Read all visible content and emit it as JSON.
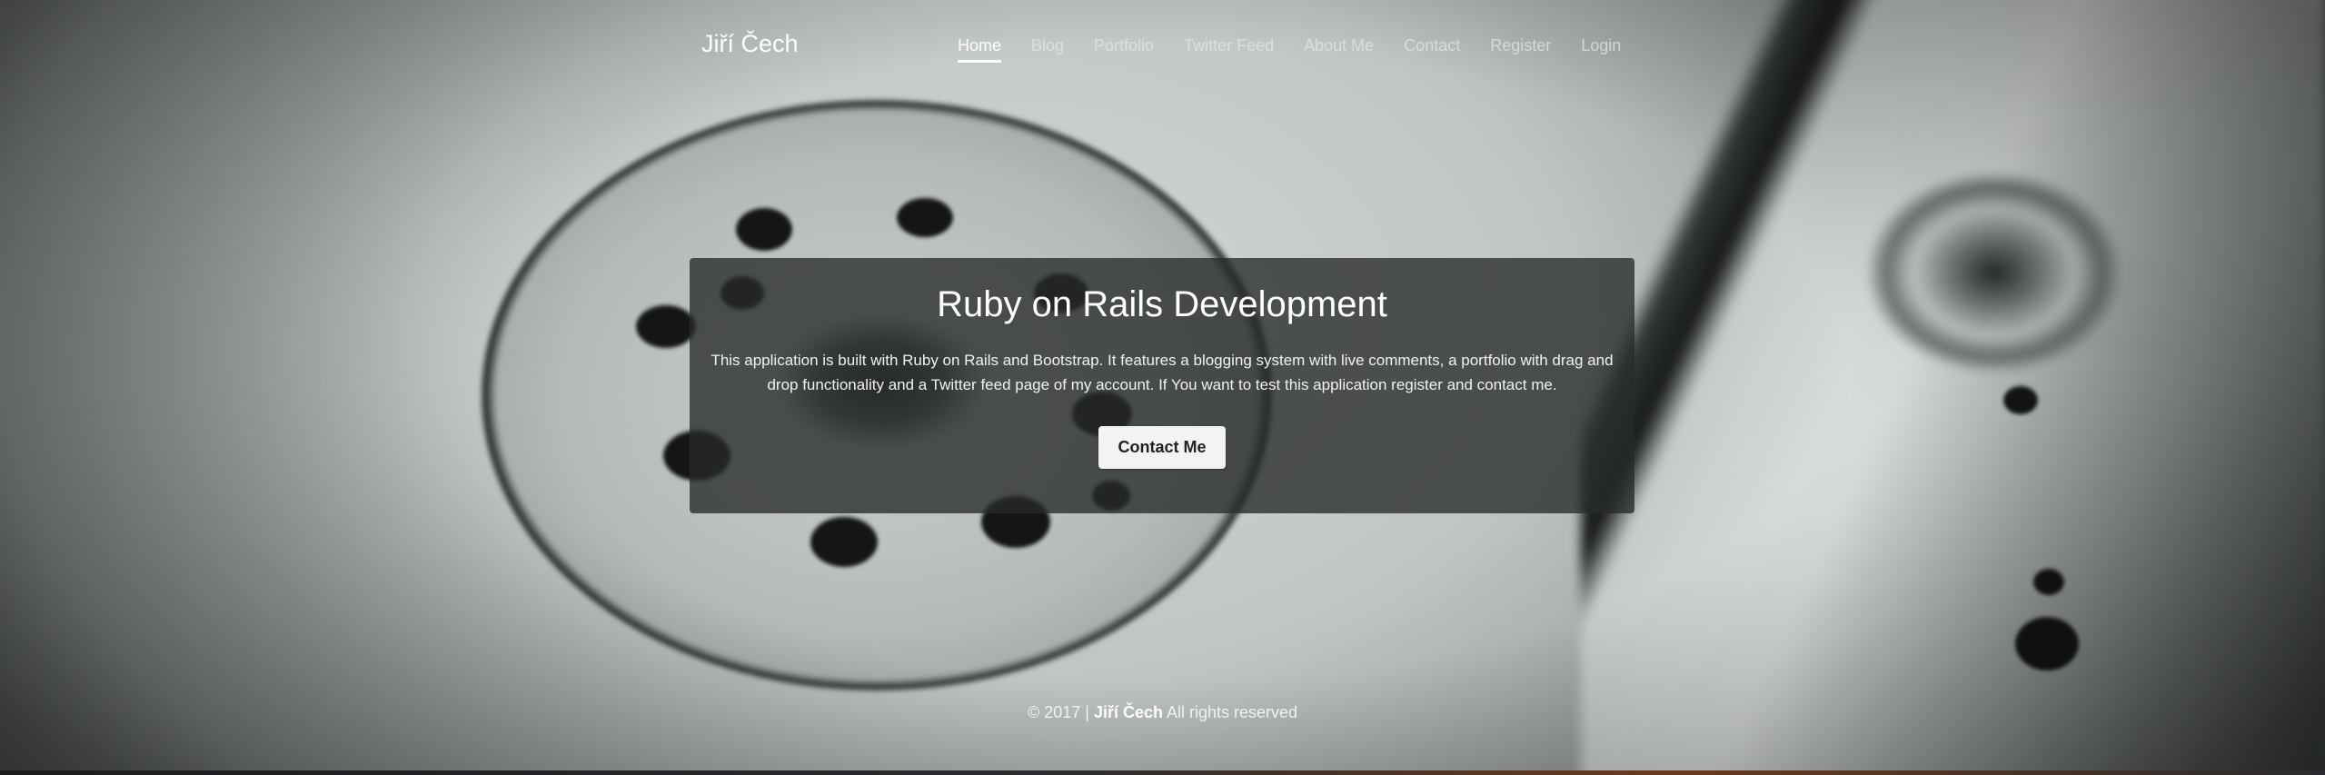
{
  "navbar": {
    "brand": "Jiří Čech",
    "items": [
      {
        "label": "Home",
        "active": true
      },
      {
        "label": "Blog",
        "active": false
      },
      {
        "label": "Portfolio",
        "active": false
      },
      {
        "label": "Twitter Feed",
        "active": false
      },
      {
        "label": "About Me",
        "active": false
      },
      {
        "label": "Contact",
        "active": false
      },
      {
        "label": "Register",
        "active": false
      },
      {
        "label": "Login",
        "active": false
      }
    ]
  },
  "jumbotron": {
    "title": "Ruby on Rails Development",
    "text": "This application is built with Ruby on Rails and Bootstrap. It features a blogging system with live comments, a portfolio with drag and drop functionality and a Twitter feed page of my account. If You want to test this application register and contact me.",
    "button_label": "Contact Me"
  },
  "footer": {
    "copyright": "© 2017 |",
    "author": "Jiří Čech",
    "rights": "All rights reserved"
  },
  "icons": {
    "background": "hard-drive-background-image"
  },
  "colors": {
    "jumbotron_bg": "#2a2c2c",
    "text": "#ffffff",
    "button_bg": "#f3f3f3"
  }
}
